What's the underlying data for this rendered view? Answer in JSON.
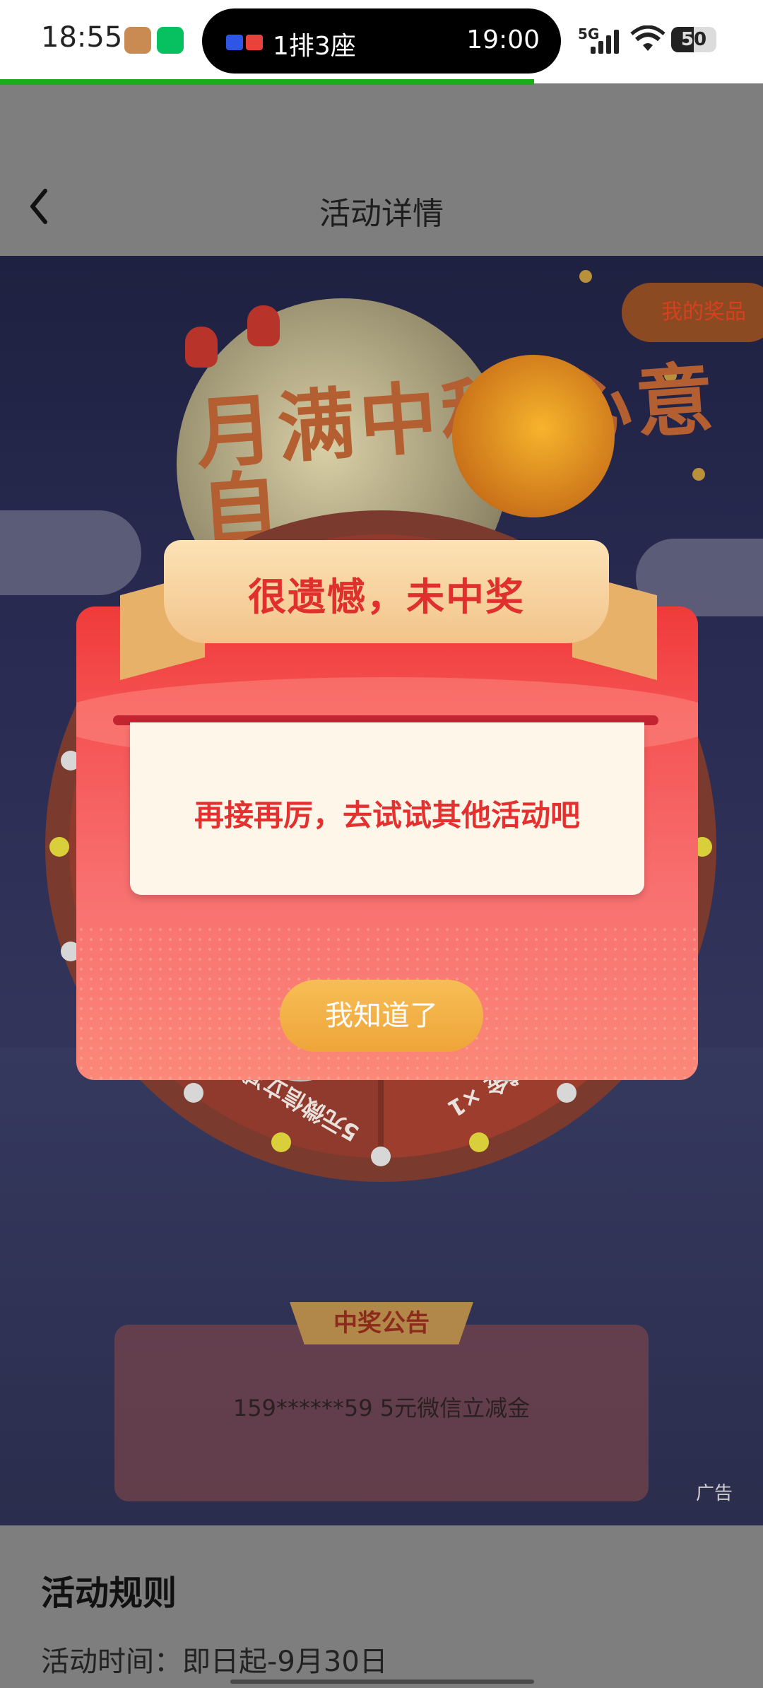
{
  "status_bar": {
    "time": "18:55",
    "island_seat": "1排3座",
    "island_time": "19:00",
    "network": "5G",
    "battery": "50",
    "icons": [
      "game-app-icon",
      "wechat-icon",
      "signal-icon",
      "wifi-icon",
      "battery-icon"
    ]
  },
  "page": {
    "title": "活动详情",
    "back_icon": "chevron-left-icon",
    "load_progress": 0.7
  },
  "hero": {
    "banner_title": "月满中秋 心意自",
    "my_prizes_label": "我的奖品",
    "wheel_segments": [
      "5元微信立减金 ×1",
      "18元微信立减金 ×1"
    ],
    "notice_tag": "中奖公告",
    "notice_text": "159******59 5元微信立减金",
    "ad_label": "广告"
  },
  "modal": {
    "ribbon_title": "很遗憾，未中奖",
    "message": "再接再厉，去试试其他活动吧",
    "confirm_label": "我知道了"
  },
  "rules": {
    "title": "活动规则",
    "time_line": "活动时间：即日起-9月30日"
  },
  "colors": {
    "accent_red": "#e4302e",
    "modal_red": "#f03a3a",
    "button_gold": "#f0a83c",
    "wechat_green": "#1aad19"
  }
}
